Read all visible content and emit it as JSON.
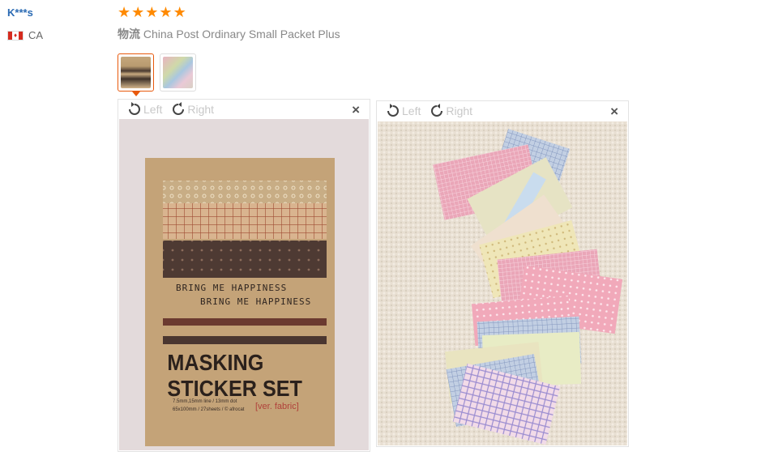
{
  "review": {
    "buyer_name": "K***s",
    "country_code": "CA",
    "star_count": 5,
    "star_glyph": "★",
    "logistics_label": "物流",
    "logistics_value": "China Post Ordinary Small Packet Plus"
  },
  "thumbnails": [
    {
      "id": "thumb-1",
      "selected": true
    },
    {
      "id": "thumb-2",
      "selected": false
    }
  ],
  "viewers": [
    {
      "rotate_left_label": "Left",
      "rotate_right_label": "Right",
      "close_glyph": "×",
      "photo": {
        "lines": [
          "BRING ME HAPPINESS",
          "BRING ME HAPPINESS"
        ],
        "title_line1": "MASKING",
        "title_line2": "STICKER SET",
        "spec_line1": "7.5mm,15mm line / 13mm dot",
        "spec_line2": "65x100mm / 27sheets / © afrocat",
        "version": "[ver. fabric]"
      }
    },
    {
      "rotate_left_label": "Left",
      "rotate_right_label": "Right",
      "close_glyph": "×"
    }
  ],
  "colors": {
    "star": "#ff8a00",
    "buyer_name": "#2a6ab3",
    "thumb_active_border": "#e8590c"
  }
}
